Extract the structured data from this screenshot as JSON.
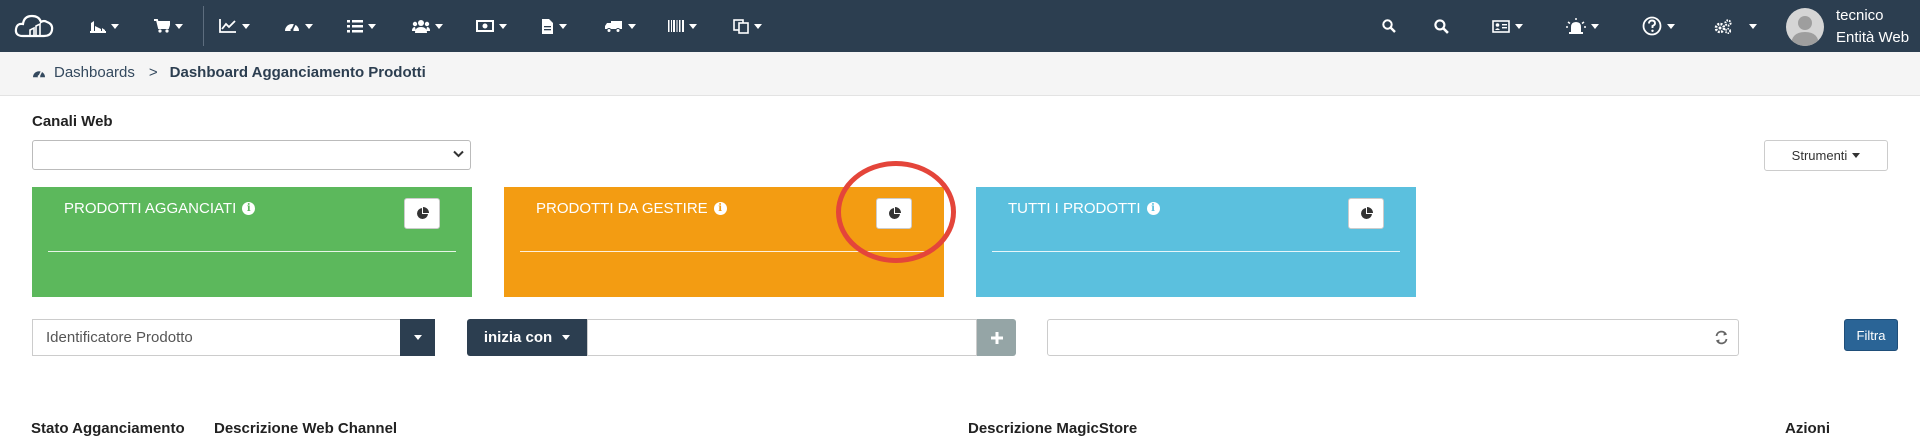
{
  "navbar": {
    "user_name": "tecnico",
    "user_entity": "Entità Web",
    "colors": {
      "bg": "#2c3e50",
      "text": "#ffffff"
    },
    "left_icons": [
      "warehouse-icon",
      "cart-icon",
      "line-chart-icon",
      "dashboard-icon",
      "list-icon",
      "users-icon",
      "money-icon",
      "document-icon",
      "truck-icon",
      "barcode-icon",
      "copy-icon"
    ],
    "right_icons": [
      "search-icon",
      "search-icon",
      "id-card-icon",
      "alarm-icon",
      "help-icon",
      "gears-icon"
    ]
  },
  "breadcrumb": {
    "root": "Dashboards",
    "separator": ">",
    "current": "Dashboard Agganciamento Prodotti"
  },
  "filters": {
    "channel_label": "Canali Web",
    "channel_value": "",
    "tools_label": "Strumenti",
    "identifier_value": "Identificatore Prodotto",
    "match_mode": "inizia con",
    "match_value": "",
    "search_value": "",
    "filter_button": "Filtra"
  },
  "cards": [
    {
      "title": "PRODOTTI AGGANCIATI",
      "color": "#5cb85c"
    },
    {
      "title": "PRODOTTI DA GESTIRE",
      "color": "#f39c12"
    },
    {
      "title": "TUTTI I PRODOTTI",
      "color": "#5bc0de"
    }
  ],
  "table": {
    "headers": [
      "Stato Agganciamento",
      "Descrizione Web Channel",
      "Descrizione MagicStore",
      "Azioni"
    ]
  },
  "annotation": {
    "color": "#e4453a"
  }
}
